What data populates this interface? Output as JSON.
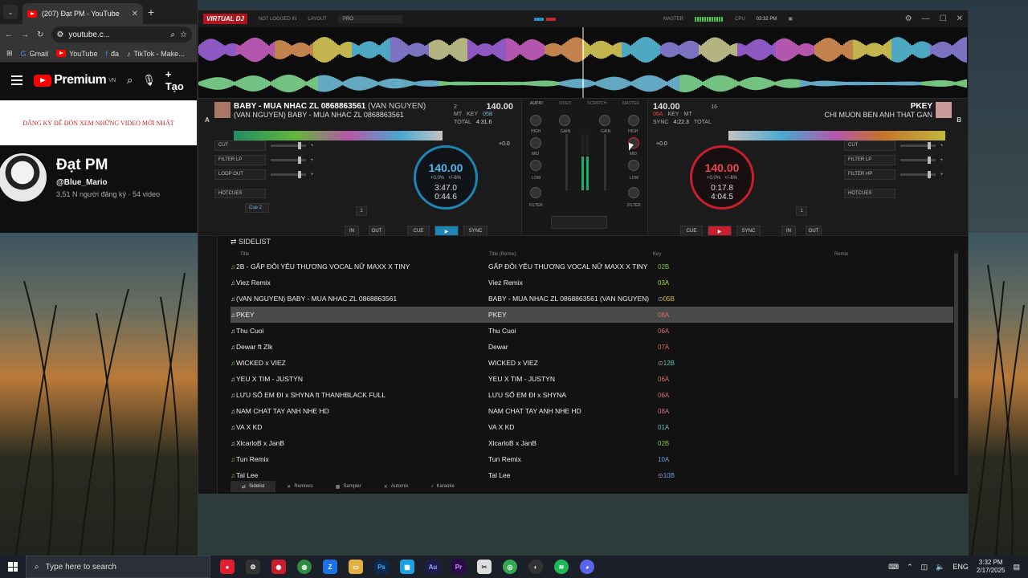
{
  "browser": {
    "tab_title": "(207) Đạt PM - YouTube",
    "url": "youtube.c...",
    "bookmarks": [
      "Gmail",
      "YouTube",
      "đa",
      "TikTok - Make..."
    ],
    "yt_logo": "Premium",
    "yt_logo_region": "VN",
    "create_label": "Tạo",
    "banner_text": "ĐĂNG KÝ ĐỂ ĐÓN XEM NHỮNG VIDEO MỚI NHẤT",
    "channel_name": "Đạt PM",
    "channel_handle": "@Blue_Mario",
    "channel_stats": "3,51 N người đăng ký · 54 video"
  },
  "vdj": {
    "logo": "VIRTUAL DJ",
    "login": "NOT LOGGED IN",
    "layout_label": "LAYOUT",
    "layout_value": "PRO",
    "master_label": "MASTER",
    "cpu_label": "CPU",
    "time": "03:32 PM",
    "deck_a": {
      "letter": "A",
      "title": "BABY - MUA NHAC ZL 0868863561",
      "title_paren": "(VAN NGUYEN)",
      "subtitle": "(VAN NGUYEN) BABY - MUA NHAC ZL 0868863561",
      "bpm": "140.00",
      "key": "05B",
      "key_label": "KEY",
      "loop_num": "2",
      "mt": "MT",
      "total_label": "TOTAL",
      "total": "4:31.6",
      "master_sync": "MASTER SYNC",
      "platter_bpm": "140.00",
      "pitch": "+0.0%",
      "pitch_range": "+/-6%",
      "elapsed": "3:47.0",
      "remain": "0:44.6",
      "gain_db": "+0.0",
      "fx": [
        "CUT",
        "FILTER LP",
        "LOOP OUT"
      ],
      "hotcues": "HOTCUES",
      "cue2": "Cue 2",
      "loop_len": "1",
      "in": "IN",
      "out": "OUT",
      "cue": "CUE",
      "play": "▶",
      "sync": "SYNC"
    },
    "deck_b": {
      "letter": "B",
      "title": "PKEY",
      "subtitle": "CHI MUON BEN ANH THAT GAN",
      "bpm": "140.00",
      "key": "06A",
      "key_label": "KEY",
      "loop_num": "16",
      "mt": "MT",
      "total_label": "TOTAL",
      "total": "4:22.3",
      "sync_label": "SYNC",
      "platter_bpm": "140.00",
      "pitch": "+0.0%",
      "pitch_range": "+/-6%",
      "elapsed": "0:17.8",
      "remain": "4:04.5",
      "gain_db": "+0.0",
      "fx": [
        "CUT",
        "FILTER LP",
        "FILTER HP"
      ],
      "hotcues": "HOTCUES",
      "loop_len": "1",
      "in": "IN",
      "out": "OUT",
      "cue": "CUE",
      "play": "▶",
      "sync": "SYNC"
    },
    "mixer": {
      "tabs": [
        "AUDIO",
        "VIDEO",
        "SCRATCH",
        "MASTER"
      ],
      "labels": [
        "HIGH",
        "GAIN",
        "MID",
        "LOW",
        "FILTER"
      ]
    },
    "browser": {
      "folder": "SIDELIST",
      "columns": [
        "Title",
        "Title (Remix)",
        "Key",
        "Remix"
      ],
      "rows": [
        {
          "title": "2B - GẤP ĐÔI YÊU THƯƠNG VOCAL NỮ MAXX X TINY",
          "remix": "GẤP ĐÔI YÊU THƯƠNG VOCAL NỮ MAXX X TINY",
          "key": "02B",
          "key_color": "#7cc23f",
          "green": true,
          "sel": false
        },
        {
          "title": "Viez Remix",
          "remix": "Viez Remix",
          "key": "03A",
          "key_color": "#a6d43a",
          "green": false,
          "sel": false
        },
        {
          "title": "(VAN NGUYEN) BABY - MUA NHAC ZL 0868863561",
          "remix": "BABY - MUA NHAC ZL 0868863561 (VAN NGUYEN)",
          "key": "05B",
          "key_color": "#e0c040",
          "green": false,
          "sel": false,
          "key_prefix": "⊙"
        },
        {
          "title": "PKEY",
          "remix": "PKEY",
          "key": "06A",
          "key_color": "#e06a6a",
          "green": false,
          "sel": true
        },
        {
          "title": "Thu Cuoi",
          "remix": "Thu Cuoi",
          "key": "06A",
          "key_color": "#e06a6a",
          "green": false,
          "sel": false
        },
        {
          "title": "Dewar ft Zlk",
          "remix": "Dewar",
          "key": "07A",
          "key_color": "#e06a6a",
          "green": false,
          "sel": false
        },
        {
          "title": "WICKED x VIEZ",
          "remix": "WICKED x VIEZ",
          "key": "12B",
          "key_color": "#58c9b0",
          "green": true,
          "sel": false,
          "key_prefix": "⊙"
        },
        {
          "title": "YEU X TIM - JUSTYN",
          "remix": "YEU X TIM - JUSTYN",
          "key": "06A",
          "key_color": "#e06a6a",
          "green": false,
          "sel": false
        },
        {
          "title": "LƯU SỐ EM ĐI x SHYNA ft THANHBLACK FULL",
          "remix": "LƯU SỐ EM ĐI x SHYNA",
          "key": "06A",
          "key_color": "#e06a6a",
          "green": false,
          "sel": false
        },
        {
          "title": "NAM CHAT TAY ANH NHE HD",
          "remix": "NAM CHAT TAY ANH NHE HD",
          "key": "08A",
          "key_color": "#e06a9a",
          "green": false,
          "sel": false
        },
        {
          "title": "VA X KD",
          "remix": "VA X KD",
          "key": "01A",
          "key_color": "#58c9b0",
          "green": false,
          "sel": false
        },
        {
          "title": "XlcarloB x JanB",
          "remix": "XlcarloB x JanB",
          "key": "02B",
          "key_color": "#7cc23f",
          "green": false,
          "sel": false
        },
        {
          "title": "Tun Remix",
          "remix": "Tun Remix",
          "key": "10A",
          "key_color": "#6aa0e0",
          "green": true,
          "sel": false
        },
        {
          "title": "Tal Lee",
          "remix": "Tal Lee",
          "key": "10B",
          "key_color": "#6aa0e0",
          "green": true,
          "sel": false,
          "key_prefix": "⊙"
        }
      ],
      "bottom_tabs": [
        "Sidelist",
        "Remixes",
        "Sampler",
        "Automix",
        "Karaoke"
      ]
    }
  },
  "taskbar": {
    "search_placeholder": "Type here to search",
    "lang": "ENG",
    "time": "3:32 PM",
    "date": "2/17/2025"
  }
}
